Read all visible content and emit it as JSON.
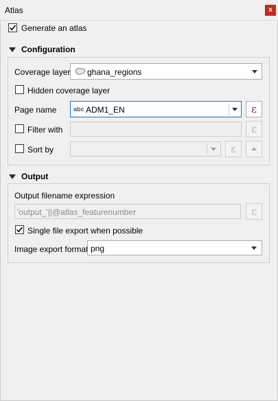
{
  "window": {
    "title": "Atlas",
    "close_glyph": "x"
  },
  "generate": {
    "label": "Generate an atlas",
    "checked": true
  },
  "configuration": {
    "header": "Configuration",
    "coverage_layer": {
      "label": "Coverage layer",
      "value": "ghana_regions",
      "icon": "polygon-layer-icon"
    },
    "hidden_coverage": {
      "label": "Hidden coverage layer",
      "checked": false
    },
    "page_name": {
      "label": "Page name",
      "type_badge": "abc",
      "value": "ADM1_EN",
      "expression_glyph": "ε"
    },
    "filter_with": {
      "label": "Filter with",
      "checked": false,
      "value": "",
      "expression_glyph": "ε"
    },
    "sort_by": {
      "label": "Sort by",
      "checked": false,
      "value": "",
      "expression_glyph": "ε",
      "order_icon": "sort-ascending-icon"
    }
  },
  "output": {
    "header": "Output",
    "filename_label": "Output filename expression",
    "filename_value": "'output_'||@atlas_featurenumber",
    "filename_expression_glyph": "ε",
    "single_file": {
      "label": "Single file export when possible",
      "checked": true
    },
    "image_format": {
      "label": "Image export format",
      "value": "png"
    }
  },
  "colors": {
    "close_button": "#c42b1c",
    "focus_border": "#0078d7",
    "expression_glyph": "#6b2a6e"
  }
}
